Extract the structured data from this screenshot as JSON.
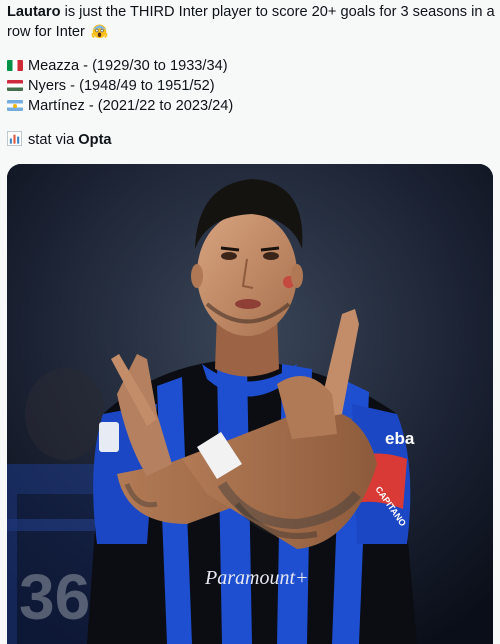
{
  "post": {
    "intro_name": "Lautaro",
    "intro_line1_rest": " is just the THIRD Inter player to score 20+ goals for 3 seasons in a",
    "intro_line2": "row for Inter",
    "intro_emoji": "face-screaming-in-fear-icon",
    "players": [
      {
        "flag": "italy-flag-icon",
        "text": "Meazza - (1929/30 to 1933/34)"
      },
      {
        "flag": "hungary-flag-icon",
        "text": "Nyers - (1948/49 to 1951/52)"
      },
      {
        "flag": "argentina-flag-icon",
        "text": "Martínez - (2021/22 to 2023/24)"
      }
    ],
    "stat_icon": "bar-chart-icon",
    "stat_prefix": "stat via ",
    "stat_source": "Opta"
  },
  "photo": {
    "description": "footballer-celebrating-crossed-fingers",
    "kit_sponsor": "Paramount+",
    "sleeve_sponsor": "eba",
    "armband_text": "CAPITANO",
    "shirt_number_bg": "36"
  },
  "colors": {
    "background": "#f7f9f9",
    "text": "#0f1419",
    "inter_blue": "#1f4fd1",
    "inter_black": "#0b0d12"
  }
}
